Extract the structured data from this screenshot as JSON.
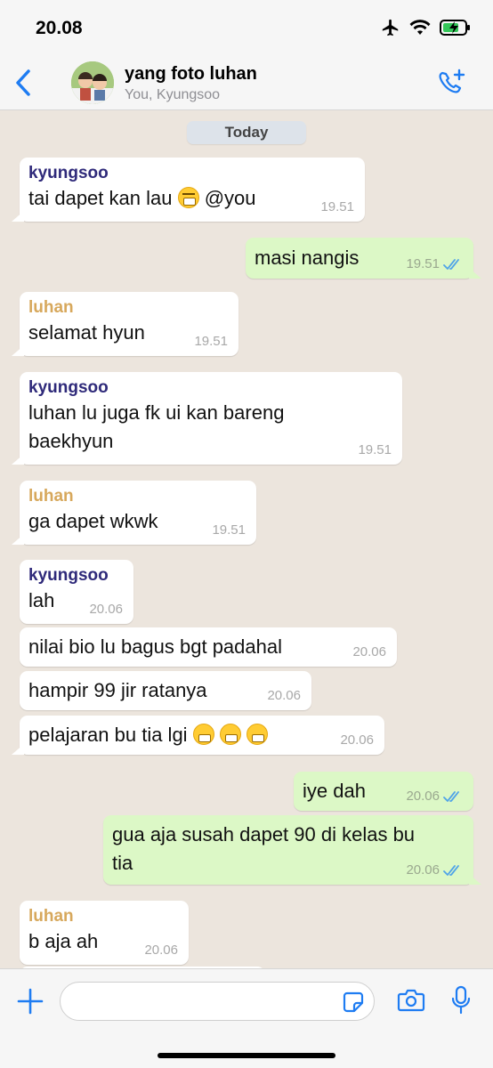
{
  "status_bar": {
    "time": "20.08"
  },
  "header": {
    "back_icon": "chevron-left-icon",
    "title": "yang foto luhan",
    "subtitle": "You, Kyungsoo",
    "call_icon": "phone-plus-icon"
  },
  "day_label": "Today",
  "colors": {
    "kyungsoo": "#2f2a7a",
    "luhan": "#d7a85c",
    "accent": "#1e7cf2",
    "outgoing": "#dcf8c6"
  },
  "messages": [
    {
      "sender": "kyungsoo",
      "text": "tai dapet kan lau",
      "emoji": "rofl",
      "tail_text": "@you",
      "time": "19.51"
    },
    {
      "text": "masi nangis",
      "time": "19.51",
      "outgoing": true
    },
    {
      "sender": "luhan",
      "text": "selamat hyun",
      "time": "19.51"
    },
    {
      "sender": "kyungsoo",
      "text": "luhan lu juga fk ui kan bareng",
      "text2": "baekhyun",
      "time": "19.51"
    },
    {
      "sender": "luhan",
      "text": "ga dapet wkwk",
      "time": "19.51"
    },
    {
      "sender": "kyungsoo",
      "text": "lah",
      "time": "20.06"
    },
    {
      "text": "nilai bio lu bagus bgt padahal",
      "time": "20.06"
    },
    {
      "text": "hampir 99 jir ratanya",
      "time": "20.06"
    },
    {
      "text": "pelajaran bu tia lgi",
      "emoji": "grimacing x3",
      "time": "20.06"
    },
    {
      "text": "iye dah",
      "time": "20.06",
      "outgoing": true
    },
    {
      "text": "gua aja susah dapet 90 di kelas bu",
      "text2": "tia",
      "time": "20.06",
      "outgoing": true
    },
    {
      "sender": "luhan",
      "text": "b aja ah",
      "time": "20.06"
    }
  ],
  "composer": {
    "plus_icon": "plus-icon",
    "sticker_icon": "sticker-icon",
    "camera_icon": "camera-icon",
    "mic_icon": "microphone-icon"
  }
}
